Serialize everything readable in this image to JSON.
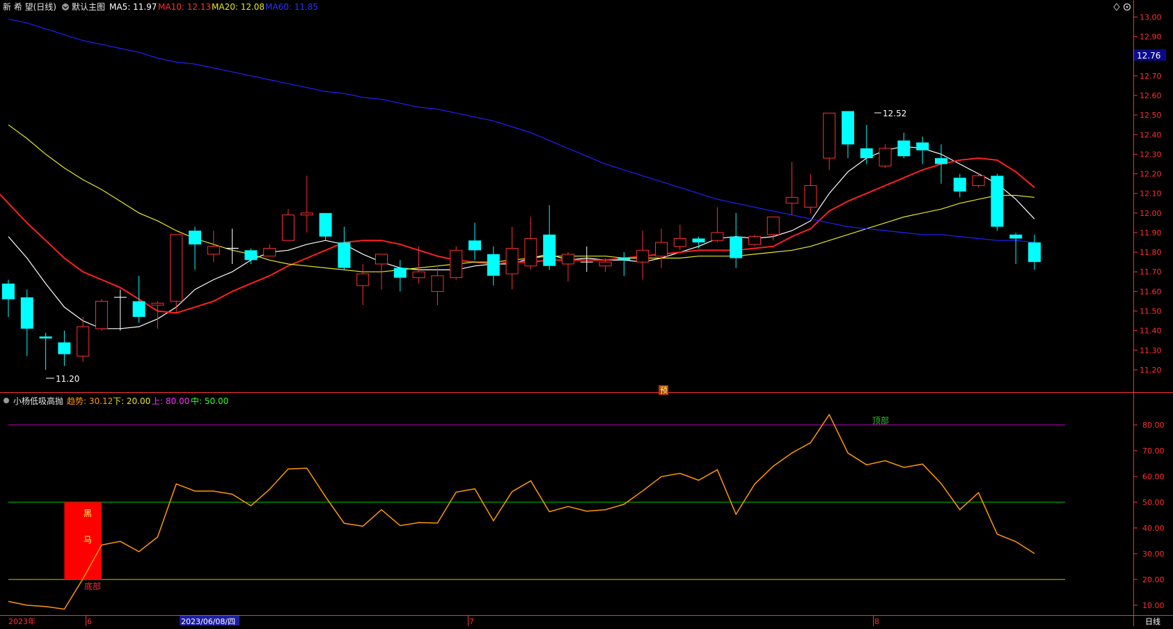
{
  "header": {
    "stock": "新 希 望(日线)",
    "menu_label": "默认主图",
    "ma5": "MA5: 11.97",
    "ma10": "MA10: 12.13",
    "ma20": "MA20: 12.08",
    "ma60": "MA60: 11.85",
    "icons": [
      "diamond-icon",
      "gear-icon"
    ]
  },
  "indicator_header": {
    "name": "小杨低吸高抛",
    "trend": "趋势: 30.12",
    "low": "下: 20.00",
    "high": "上: 80.00",
    "mid": "中: 50.00"
  },
  "annotations": {
    "low_price": "11.20",
    "high_price": "12.52",
    "current_price": "12.76",
    "forecast_mark": "预",
    "top_label": "顶部",
    "bottom_label": "底部",
    "dark_horse_1": "黑",
    "dark_horse_2": "马"
  },
  "bottom_bar": {
    "year": "2023年",
    "m6": "6",
    "cursor_date": "2023/06/08/四",
    "m7": "7",
    "m8": "8",
    "period": "日线"
  },
  "colors": {
    "up": "#ff3030",
    "down": "#00ffff",
    "ma5": "#ffffff",
    "ma10": "#ff2020",
    "ma20": "#e8e820",
    "ma60": "#2020ff",
    "trend": "#ff9900",
    "line80": "#cc00cc",
    "line50": "#00cc00",
    "line20": "#c8c800",
    "axis": "#ff3030"
  },
  "chart_data": [
    {
      "type": "candlestick",
      "y_ticks": [
        "13.00",
        "12.90",
        "12.80",
        "12.70",
        "12.60",
        "12.50",
        "12.40",
        "12.30",
        "12.20",
        "12.10",
        "12.00",
        "11.90",
        "11.80",
        "11.70",
        "11.60",
        "11.50",
        "11.40",
        "11.30",
        "11.20"
      ],
      "ylim": [
        11.15,
        13.03
      ],
      "candles": [
        {
          "o": 11.64,
          "c": 11.56,
          "h": 11.66,
          "l": 11.47
        },
        {
          "o": 11.57,
          "c": 11.41,
          "h": 11.61,
          "l": 11.27
        },
        {
          "o": 11.37,
          "c": 11.36,
          "h": 11.39,
          "l": 11.2
        },
        {
          "o": 11.34,
          "c": 11.28,
          "h": 11.4,
          "l": 11.22
        },
        {
          "o": 11.27,
          "c": 11.42,
          "h": 11.47,
          "l": 11.24
        },
        {
          "o": 11.41,
          "c": 11.55,
          "h": 11.56,
          "l": 11.4
        },
        {
          "o": 11.57,
          "c": 11.57,
          "h": 11.61,
          "l": 11.4
        },
        {
          "o": 11.55,
          "c": 11.47,
          "h": 11.68,
          "l": 11.44
        },
        {
          "o": 11.53,
          "c": 11.54,
          "h": 11.55,
          "l": 11.41
        },
        {
          "o": 11.55,
          "c": 11.89,
          "h": 11.89,
          "l": 11.49
        },
        {
          "o": 11.91,
          "c": 11.84,
          "h": 11.93,
          "l": 11.71
        },
        {
          "o": 11.79,
          "c": 11.83,
          "h": 11.91,
          "l": 11.75
        },
        {
          "o": 11.82,
          "c": 11.82,
          "h": 11.92,
          "l": 11.74
        },
        {
          "o": 11.81,
          "c": 11.76,
          "h": 11.82,
          "l": 11.74
        },
        {
          "o": 11.78,
          "c": 11.82,
          "h": 11.84,
          "l": 11.78
        },
        {
          "o": 11.86,
          "c": 11.99,
          "h": 12.02,
          "l": 11.86
        },
        {
          "o": 11.99,
          "c": 12.0,
          "h": 12.19,
          "l": 11.9
        },
        {
          "o": 12.0,
          "c": 11.88,
          "h": 12.0,
          "l": 11.86
        },
        {
          "o": 11.85,
          "c": 11.72,
          "h": 11.93,
          "l": 11.71
        },
        {
          "o": 11.63,
          "c": 11.69,
          "h": 11.74,
          "l": 11.53
        },
        {
          "o": 11.74,
          "c": 11.79,
          "h": 11.79,
          "l": 11.61
        },
        {
          "o": 11.72,
          "c": 11.67,
          "h": 11.76,
          "l": 11.6
        },
        {
          "o": 11.67,
          "c": 11.7,
          "h": 11.83,
          "l": 11.64
        },
        {
          "o": 11.6,
          "c": 11.68,
          "h": 11.72,
          "l": 11.53
        },
        {
          "o": 11.67,
          "c": 11.81,
          "h": 11.83,
          "l": 11.66
        },
        {
          "o": 11.86,
          "c": 11.81,
          "h": 11.95,
          "l": 11.76
        },
        {
          "o": 11.79,
          "c": 11.68,
          "h": 11.83,
          "l": 11.63
        },
        {
          "o": 11.69,
          "c": 11.82,
          "h": 11.93,
          "l": 11.61
        },
        {
          "o": 11.73,
          "c": 11.87,
          "h": 11.98,
          "l": 11.71
        },
        {
          "o": 11.89,
          "c": 11.73,
          "h": 12.04,
          "l": 11.71
        },
        {
          "o": 11.74,
          "c": 11.79,
          "h": 11.8,
          "l": 11.65
        },
        {
          "o": 11.75,
          "c": 11.75,
          "h": 11.83,
          "l": 11.7
        },
        {
          "o": 11.73,
          "c": 11.75,
          "h": 11.77,
          "l": 11.7
        },
        {
          "o": 11.77,
          "c": 11.76,
          "h": 11.8,
          "l": 11.68
        },
        {
          "o": 11.75,
          "c": 11.81,
          "h": 11.91,
          "l": 11.66
        },
        {
          "o": 11.78,
          "c": 11.85,
          "h": 11.92,
          "l": 11.72
        },
        {
          "o": 11.83,
          "c": 11.87,
          "h": 11.94,
          "l": 11.81
        },
        {
          "o": 11.87,
          "c": 11.85,
          "h": 11.88,
          "l": 11.82
        },
        {
          "o": 11.86,
          "c": 11.9,
          "h": 12.03,
          "l": 11.85
        },
        {
          "o": 11.88,
          "c": 11.77,
          "h": 12.0,
          "l": 11.72
        },
        {
          "o": 11.84,
          "c": 11.88,
          "h": 11.89,
          "l": 11.83
        },
        {
          "o": 11.89,
          "c": 11.98,
          "h": 11.98,
          "l": 11.86
        },
        {
          "o": 12.05,
          "c": 12.08,
          "h": 12.26,
          "l": 11.99
        },
        {
          "o": 12.03,
          "c": 12.14,
          "h": 12.2,
          "l": 12.0
        },
        {
          "o": 12.28,
          "c": 12.51,
          "h": 12.51,
          "l": 12.22
        },
        {
          "o": 12.52,
          "c": 12.35,
          "h": 12.52,
          "l": 12.28
        },
        {
          "o": 12.33,
          "c": 12.28,
          "h": 12.45,
          "l": 12.25
        },
        {
          "o": 12.24,
          "c": 12.33,
          "h": 12.35,
          "l": 12.23
        },
        {
          "o": 12.37,
          "c": 12.29,
          "h": 12.41,
          "l": 12.28
        },
        {
          "o": 12.36,
          "c": 12.32,
          "h": 12.39,
          "l": 12.25
        },
        {
          "o": 12.28,
          "c": 12.25,
          "h": 12.35,
          "l": 12.15
        },
        {
          "o": 12.18,
          "c": 12.11,
          "h": 12.2,
          "l": 12.08
        },
        {
          "o": 12.14,
          "c": 12.19,
          "h": 12.2,
          "l": 12.13
        },
        {
          "o": 12.19,
          "c": 11.93,
          "h": 12.2,
          "l": 11.91
        },
        {
          "o": 11.89,
          "c": 11.87,
          "h": 11.9,
          "l": 11.74
        },
        {
          "o": 11.85,
          "c": 11.75,
          "h": 11.89,
          "l": 11.71
        }
      ],
      "series": [
        {
          "name": "MA5",
          "values": [
            11.88,
            11.77,
            11.64,
            11.52,
            11.45,
            11.41,
            11.41,
            11.42,
            11.46,
            11.52,
            11.61,
            11.66,
            11.7,
            11.76,
            11.8,
            11.81,
            11.84,
            11.86,
            11.84,
            11.79,
            11.75,
            11.72,
            11.71,
            11.71,
            11.71,
            11.73,
            11.74,
            11.74,
            11.77,
            11.79,
            11.76,
            11.77,
            11.76,
            11.76,
            11.75,
            11.77,
            11.8,
            11.83,
            11.87,
            11.88,
            11.87,
            11.88,
            11.91,
            11.96,
            12.1,
            12.21,
            12.28,
            12.32,
            12.34,
            12.33,
            12.3,
            12.25,
            12.2,
            12.15,
            12.07,
            11.97
          ]
        },
        {
          "name": "MA10",
          "values": [
            12.15,
            12.05,
            11.95,
            11.86,
            11.77,
            11.7,
            11.66,
            11.62,
            11.56,
            11.5,
            11.49,
            11.52,
            11.55,
            11.6,
            11.64,
            11.68,
            11.73,
            11.77,
            11.81,
            11.85,
            11.86,
            11.86,
            11.84,
            11.81,
            11.78,
            11.76,
            11.75,
            11.74,
            11.75,
            11.75,
            11.76,
            11.76,
            11.76,
            11.76,
            11.77,
            11.78,
            11.79,
            11.8,
            11.81,
            11.81,
            11.81,
            11.82,
            11.83,
            11.88,
            11.92,
            12.01,
            12.06,
            12.1,
            12.14,
            12.18,
            12.22,
            12.25,
            12.27,
            12.28,
            12.27,
            12.21,
            12.13
          ]
        },
        {
          "name": "MA20",
          "values": [
            12.45,
            12.38,
            12.3,
            12.23,
            12.17,
            12.12,
            12.06,
            12.0,
            11.96,
            11.91,
            11.87,
            11.84,
            11.81,
            11.79,
            11.76,
            11.74,
            11.73,
            11.72,
            11.71,
            11.7,
            11.7,
            11.71,
            11.72,
            11.73,
            11.74,
            11.75,
            11.75,
            11.76,
            11.77,
            11.78,
            11.78,
            11.78,
            11.78,
            11.77,
            11.77,
            11.77,
            11.77,
            11.78,
            11.78,
            11.78,
            11.79,
            11.8,
            11.81,
            11.83,
            11.86,
            11.89,
            11.92,
            11.95,
            11.98,
            12.0,
            12.02,
            12.05,
            12.07,
            12.09,
            12.09,
            12.08
          ]
        },
        {
          "name": "MA60",
          "values": [
            12.99,
            12.97,
            12.94,
            12.91,
            12.88,
            12.86,
            12.84,
            12.82,
            12.79,
            12.77,
            12.76,
            12.74,
            12.72,
            12.7,
            12.68,
            12.66,
            12.64,
            12.62,
            12.61,
            12.59,
            12.58,
            12.56,
            12.54,
            12.53,
            12.51,
            12.49,
            12.47,
            12.44,
            12.41,
            12.37,
            12.33,
            12.29,
            12.25,
            12.22,
            12.19,
            12.16,
            12.13,
            12.1,
            12.07,
            12.05,
            12.03,
            12.01,
            11.99,
            11.97,
            11.95,
            11.93,
            11.92,
            11.91,
            11.9,
            11.89,
            11.89,
            11.88,
            11.87,
            11.86,
            11.86,
            11.85
          ]
        }
      ]
    },
    {
      "type": "line",
      "y_ticks": [
        "80.00",
        "70.00",
        "60.00",
        "50.00",
        "40.00",
        "30.00",
        "20.00",
        "10.00"
      ],
      "ylim": [
        7,
        90
      ],
      "series": [
        {
          "name": "趋势",
          "values": [
            11.5,
            10.0,
            9.5,
            8.5,
            20.3,
            33.4,
            34.8,
            30.8,
            36.5,
            57.1,
            54.3,
            54.3,
            53.1,
            48.6,
            55.0,
            62.9,
            63.2,
            52.1,
            41.8,
            40.7,
            47.1,
            40.9,
            42.1,
            41.9,
            53.9,
            55.2,
            42.8,
            54.1,
            58.3,
            46.3,
            48.3,
            46.5,
            47.1,
            49.2,
            54.4,
            59.9,
            61.2,
            58.5,
            62.6,
            45.3,
            57.0,
            64.0,
            69.1,
            73.1,
            84.0,
            69.1,
            64.5,
            66.1,
            63.5,
            64.8,
            57.2,
            47.1,
            53.7,
            37.6,
            34.7,
            30.1
          ]
        }
      ],
      "reference_lines": [
        80,
        50,
        20
      ],
      "signal_index": 4
    }
  ]
}
